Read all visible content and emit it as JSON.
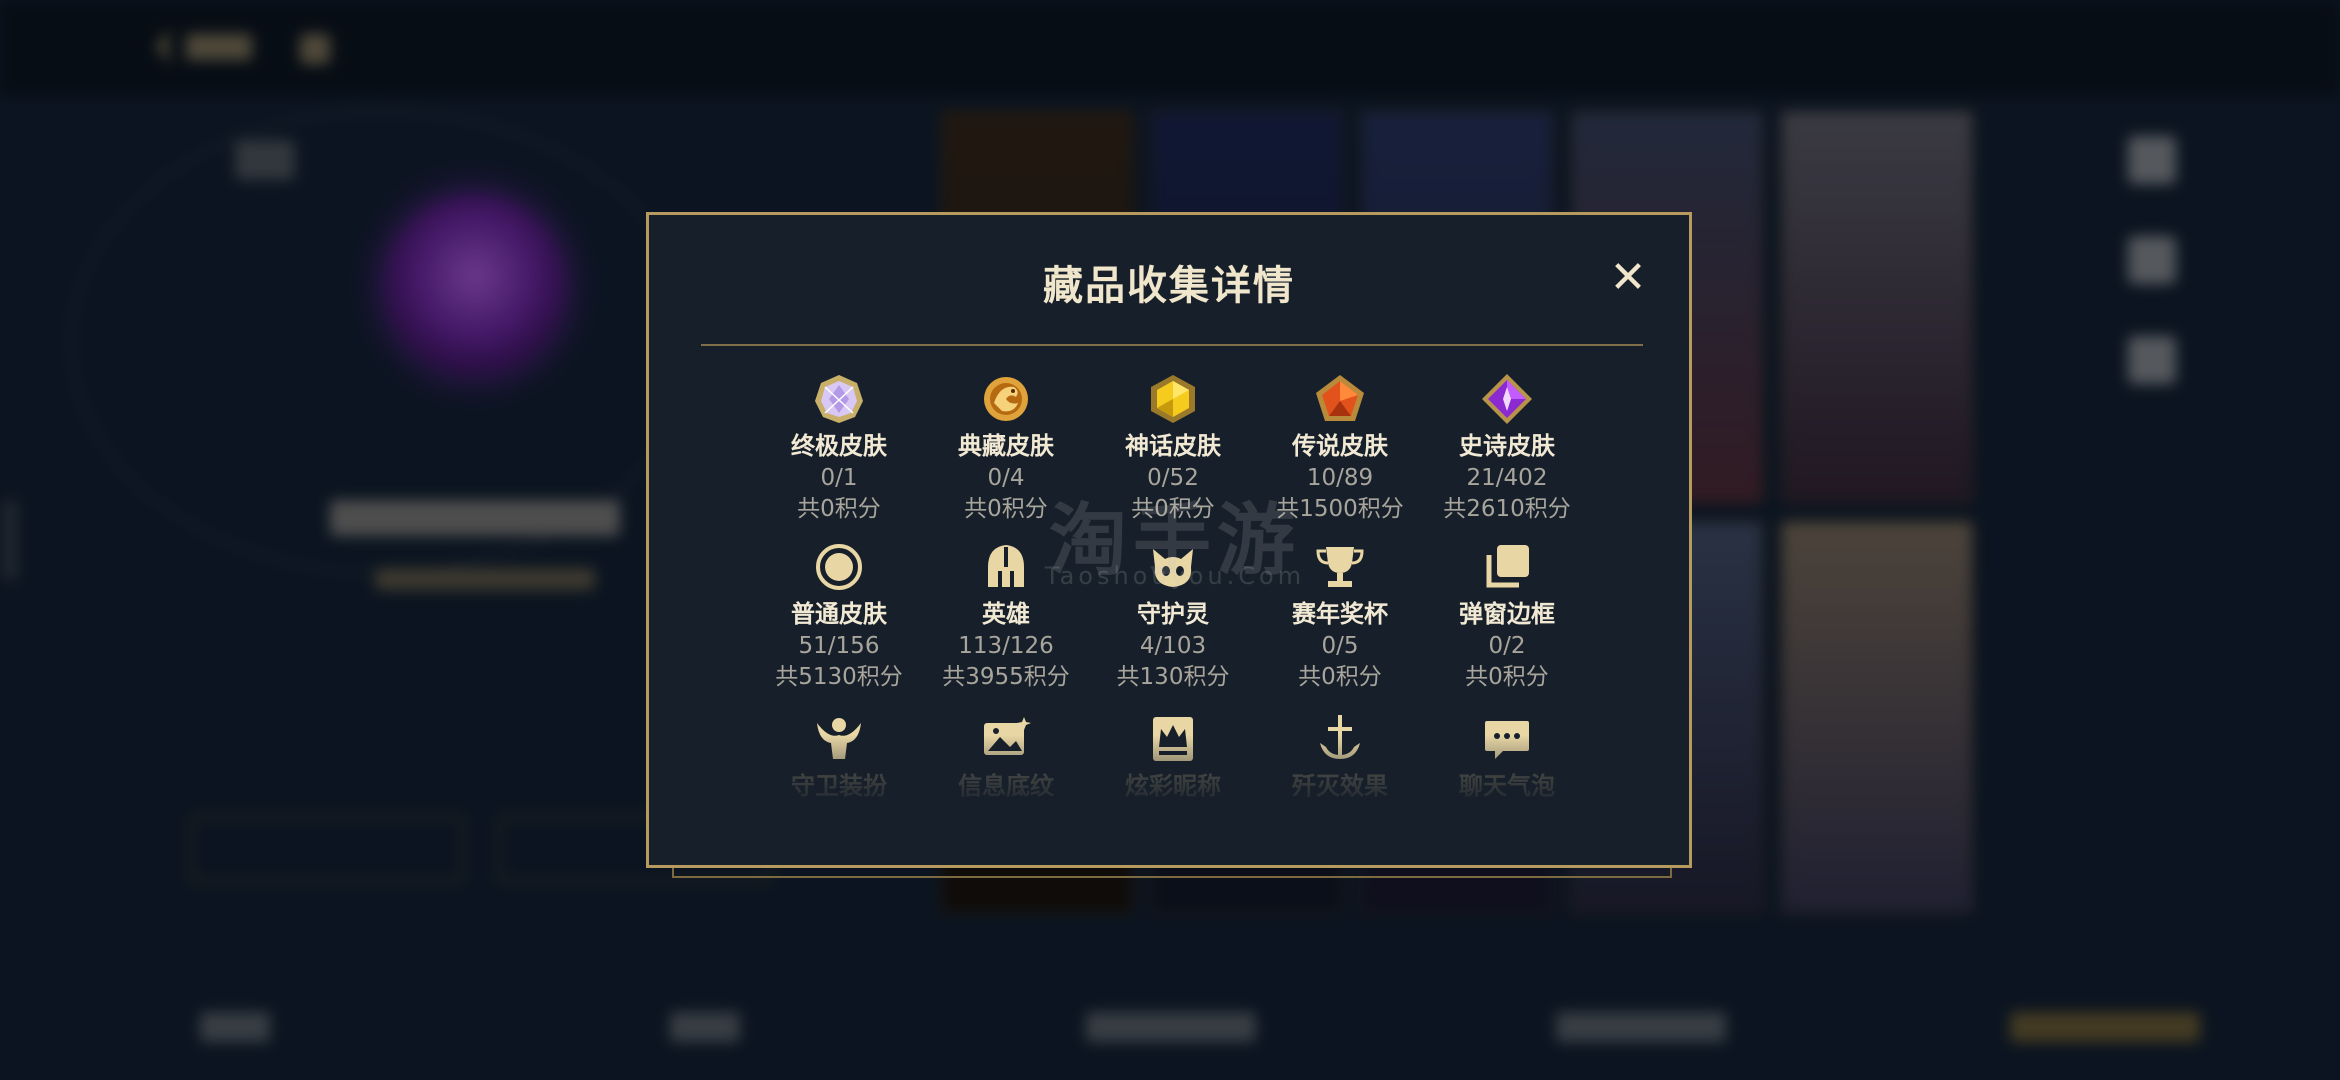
{
  "dialog": {
    "title": "藏品收集详情",
    "close_glyph": "✕",
    "rows": [
      [
        {
          "icon": "ultimate-skin-gem-icon",
          "label": "终极皮肤",
          "count": "0/1",
          "points": "共0积分"
        },
        {
          "icon": "collector-skin-dragon-icon",
          "label": "典藏皮肤",
          "count": "0/4",
          "points": "共0积分"
        },
        {
          "icon": "mythic-skin-gem-icon",
          "label": "神话皮肤",
          "count": "0/52",
          "points": "共0积分"
        },
        {
          "icon": "legendary-skin-gem-icon",
          "label": "传说皮肤",
          "count": "10/89",
          "points": "共1500积分"
        },
        {
          "icon": "epic-skin-gem-icon",
          "label": "史诗皮肤",
          "count": "21/402",
          "points": "共2610积分"
        }
      ],
      [
        {
          "icon": "normal-skin-ring-icon",
          "label": "普通皮肤",
          "count": "51/156",
          "points": "共5130积分"
        },
        {
          "icon": "hero-helmet-icon",
          "label": "英雄",
          "count": "113/126",
          "points": "共3955积分"
        },
        {
          "icon": "guardian-spirit-icon",
          "label": "守护灵",
          "count": "4/103",
          "points": "共130积分"
        },
        {
          "icon": "season-trophy-icon",
          "label": "赛年奖杯",
          "count": "0/5",
          "points": "共0积分"
        },
        {
          "icon": "popup-frame-icon",
          "label": "弹窗边框",
          "count": "0/2",
          "points": "共0积分"
        }
      ],
      [
        {
          "icon": "guardian-outfit-icon",
          "label": "守卫装扮"
        },
        {
          "icon": "info-background-icon",
          "label": "信息底纹"
        },
        {
          "icon": "colorful-nickname-crown-icon",
          "label": "炫彩昵称"
        },
        {
          "icon": "elimination-effect-anchor-icon",
          "label": "歼灭效果"
        },
        {
          "icon": "chat-bubble-icon",
          "label": "聊天气泡"
        }
      ]
    ]
  },
  "watermark": {
    "main": "淘手游",
    "sub": "Taoshouyou.Com"
  },
  "colors": {
    "dialog_bg": "#17202a",
    "dialog_border": "#b69a5e",
    "title": "#f0e6cc",
    "label": "#f1e9d4",
    "muted": "#a8a59c",
    "gold_icon": "#e8d6a4"
  }
}
